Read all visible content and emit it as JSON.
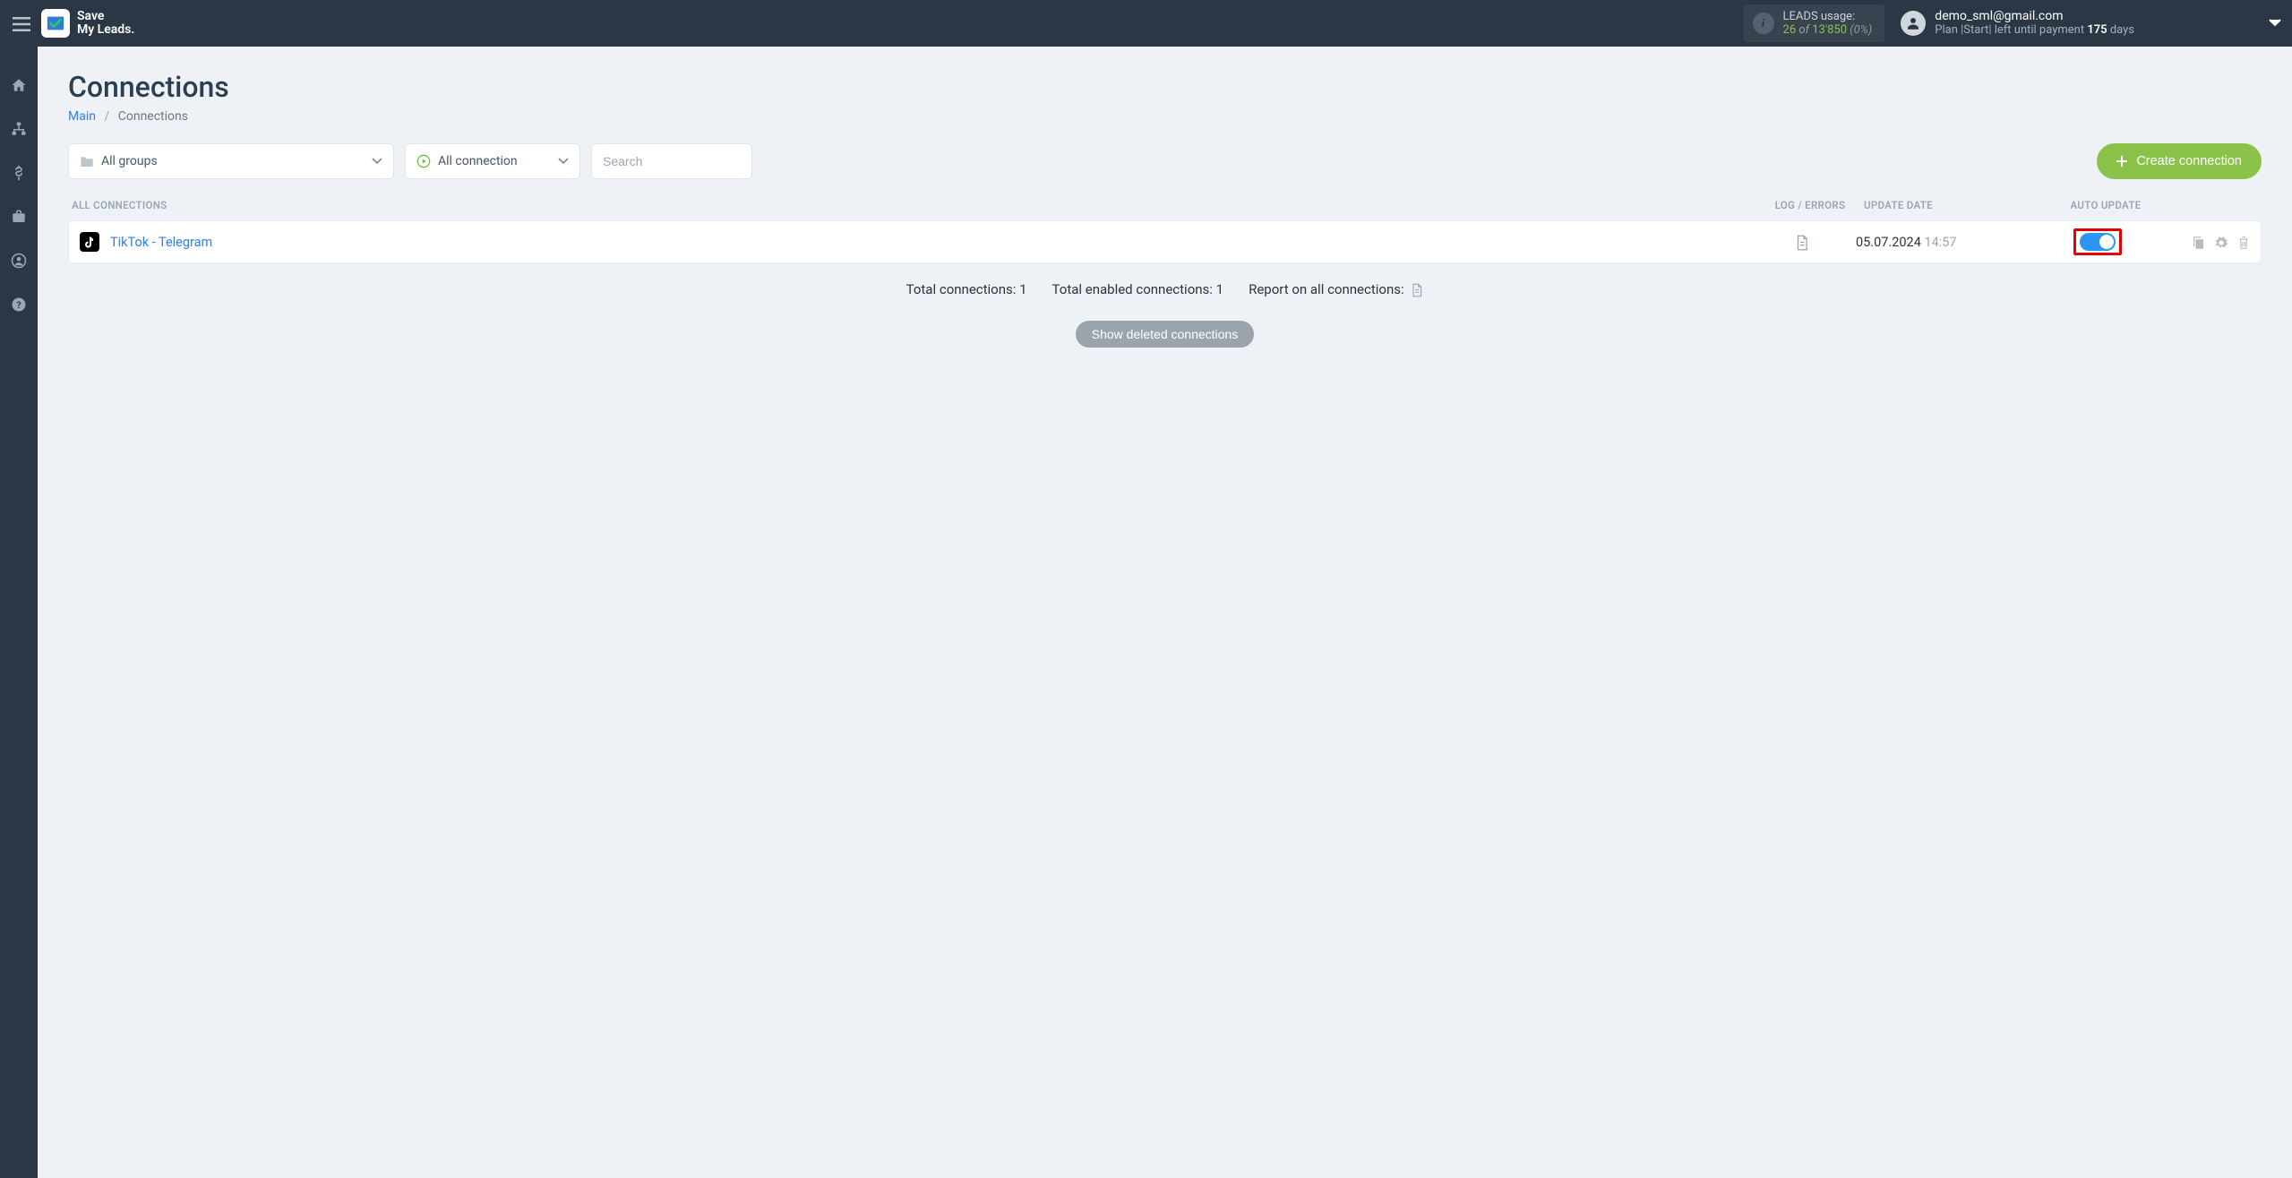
{
  "header": {
    "logo_line1": "Save",
    "logo_line2": "My Leads.",
    "leads_usage_label": "LEADS usage:",
    "leads_used": "26",
    "leads_of": "of",
    "leads_quota": "13'850",
    "leads_pct": "(0%)",
    "user_email": "demo_sml@gmail.com",
    "user_plan_prefix": "Plan |Start| left until payment ",
    "user_plan_days_num": "175",
    "user_plan_days_word": " days"
  },
  "page": {
    "title": "Connections",
    "breadcrumb_main": "Main",
    "breadcrumb_current": "Connections"
  },
  "filters": {
    "groups_label": "All groups",
    "status_label": "All connection",
    "search_placeholder": "Search",
    "create_label": "Create connection"
  },
  "columns": {
    "all": "All connections",
    "log": "Log / Errors",
    "date": "Update date",
    "auto": "Auto update"
  },
  "rows": [
    {
      "name": "TikTok - Telegram",
      "date": "05.07.2024",
      "time": "14:57",
      "auto_update": true
    }
  ],
  "summary": {
    "total_label": "Total connections: ",
    "total_value": "1",
    "enabled_label": "Total enabled connections: ",
    "enabled_value": "1",
    "report_label": "Report on all connections:"
  },
  "show_deleted": "Show deleted connections"
}
